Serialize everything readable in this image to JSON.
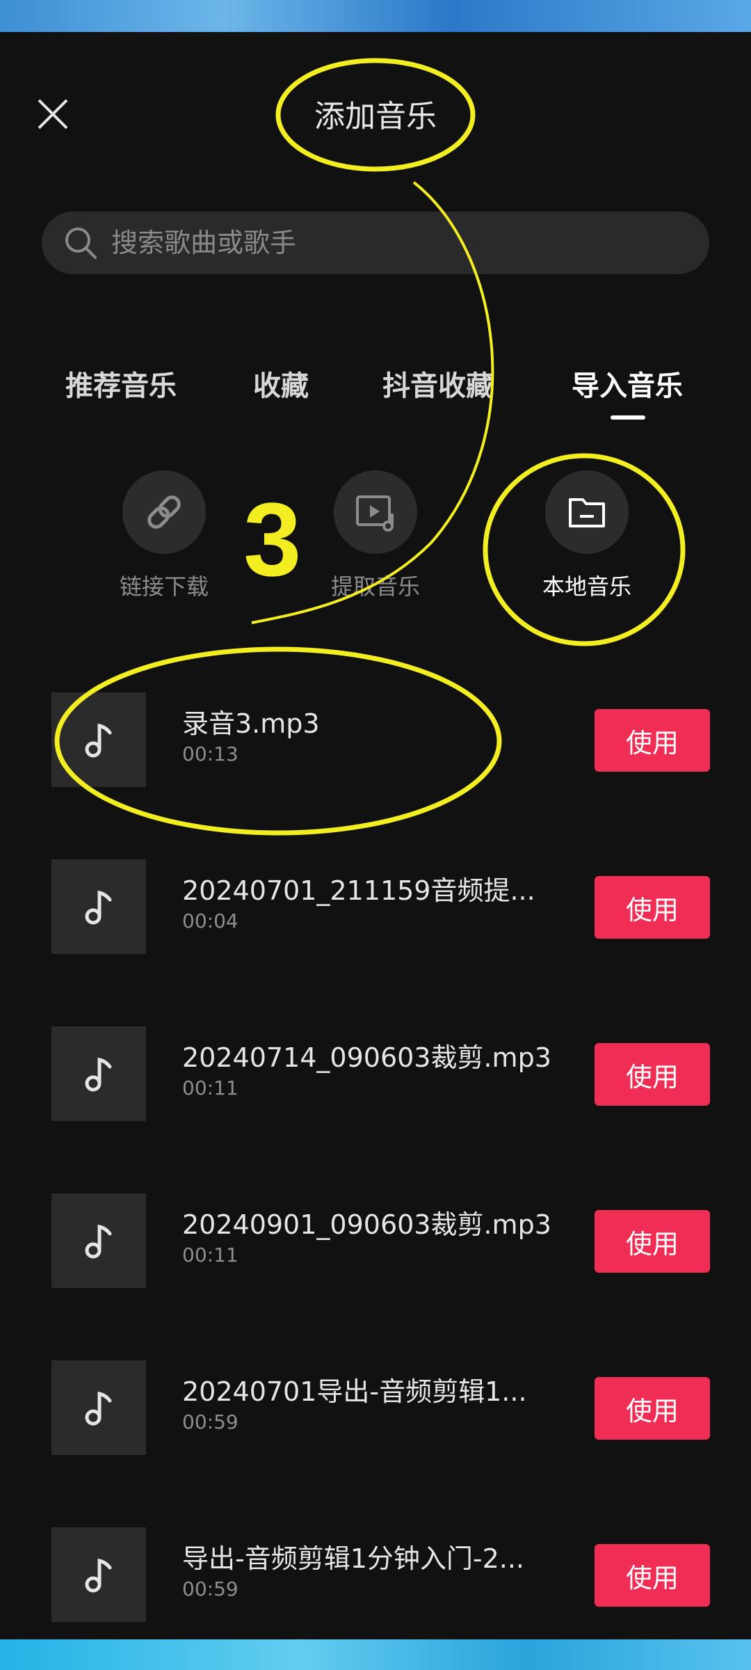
{
  "header": {
    "title": "添加音乐"
  },
  "search": {
    "placeholder": "搜索歌曲或歌手"
  },
  "tabs": [
    {
      "label": "推荐音乐"
    },
    {
      "label": "收藏"
    },
    {
      "label": "抖音收藏"
    },
    {
      "label": "导入音乐"
    }
  ],
  "actions": [
    {
      "label": "链接下载",
      "icon": "link-icon"
    },
    {
      "label": "提取音乐",
      "icon": "extract-video-icon"
    },
    {
      "label": "本地音乐",
      "icon": "folder-icon"
    }
  ],
  "annotation": {
    "step_number": "3",
    "color": "#f2ee22"
  },
  "songs": [
    {
      "title": "录音3.mp3",
      "duration": "00:13",
      "use_label": "使用"
    },
    {
      "title": "20240701_211159音频提...",
      "duration": "00:04",
      "use_label": "使用"
    },
    {
      "title": "20240714_090603裁剪.mp3",
      "duration": "00:11",
      "use_label": "使用"
    },
    {
      "title": "20240901_090603裁剪.mp3",
      "duration": "00:11",
      "use_label": "使用"
    },
    {
      "title": "20240701导出-音频剪辑1...",
      "duration": "00:59",
      "use_label": "使用"
    },
    {
      "title": "导出-音频剪辑1分钟入门-2...",
      "duration": "00:59",
      "use_label": "使用"
    }
  ],
  "colors": {
    "accent": "#f02e55",
    "background": "#111111"
  }
}
